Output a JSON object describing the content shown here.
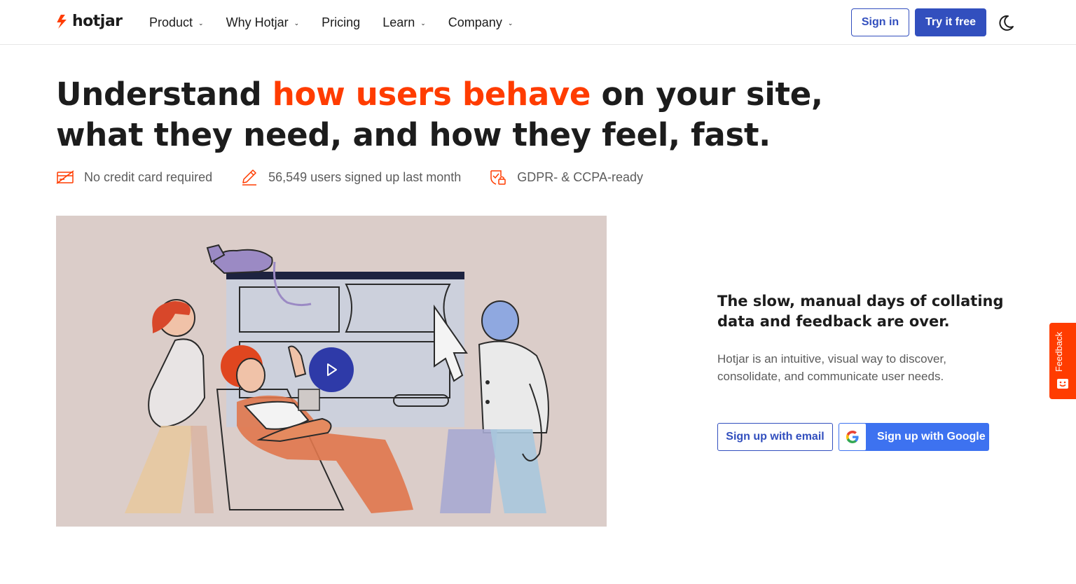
{
  "header": {
    "logo_text": "hotjar",
    "nav": [
      {
        "label": "Product",
        "has_dropdown": true
      },
      {
        "label": "Why Hotjar",
        "has_dropdown": true
      },
      {
        "label": "Pricing",
        "has_dropdown": false
      },
      {
        "label": "Learn",
        "has_dropdown": true
      },
      {
        "label": "Company",
        "has_dropdown": true
      }
    ],
    "signin_label": "Sign in",
    "try_label": "Try it free",
    "theme_icon": "moon-icon"
  },
  "hero": {
    "headline_part1": "Understand ",
    "headline_accent": "how users behave",
    "headline_part2": " on your site, what they need, and how they feel, fast.",
    "features": [
      {
        "icon": "credit-card-icon",
        "text": "No credit card required"
      },
      {
        "icon": "pencil-icon",
        "text": "56,549 users signed up last month"
      },
      {
        "icon": "shield-lock-icon",
        "text": "GDPR- & CCPA-ready"
      }
    ]
  },
  "video": {
    "play_icon": "play-icon"
  },
  "cta": {
    "heading": "The slow, manual days of collating data and feedback are over.",
    "description": "Hotjar is an intuitive, visual way to discover, consolidate, and communicate user needs.",
    "email_button": "Sign up with email",
    "google_button": "Sign up with Google"
  },
  "feedback_tab": {
    "label": "Feedback"
  },
  "colors": {
    "accent": "#ff3c00",
    "primary": "#324fbe",
    "google_blue": "#3d72f0"
  }
}
